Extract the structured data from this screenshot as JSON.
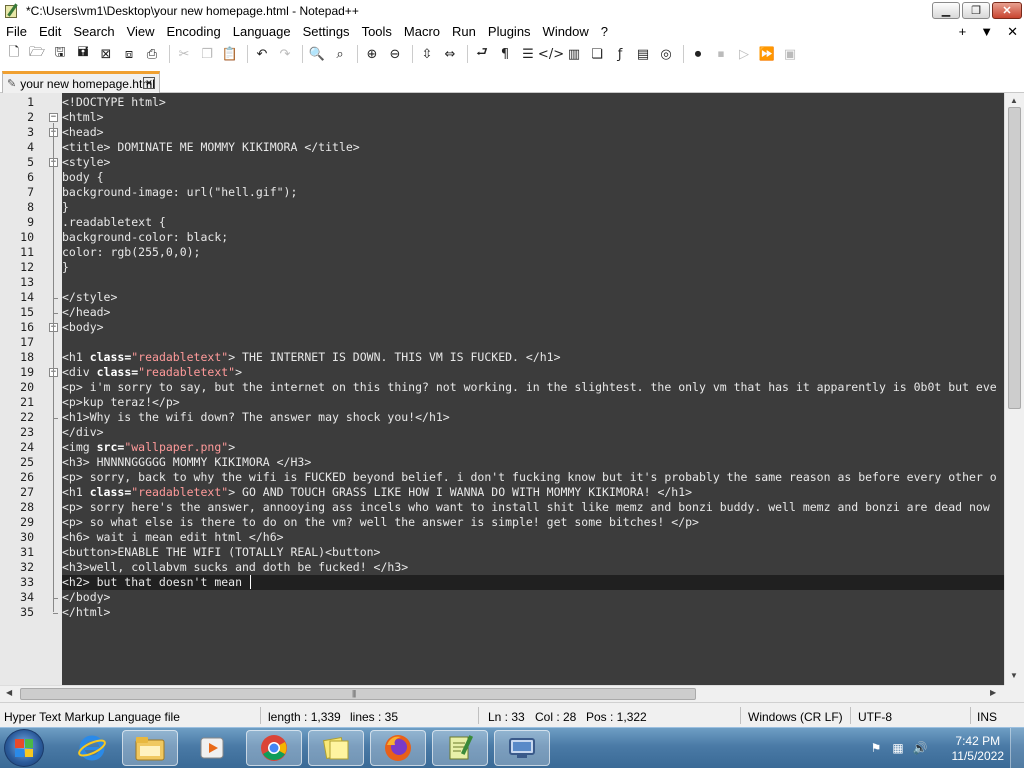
{
  "window": {
    "title": "*C:\\Users\\vm1\\Desktop\\your new homepage.html - Notepad++",
    "minimize_glyph": "▁",
    "maximize_glyph": "❐",
    "close_glyph": "✕"
  },
  "menu": {
    "items": [
      "File",
      "Edit",
      "Search",
      "View",
      "Encoding",
      "Language",
      "Settings",
      "Tools",
      "Macro",
      "Run",
      "Plugins",
      "Window",
      "?"
    ],
    "right": [
      "+",
      "▼",
      "✕"
    ]
  },
  "toolbar": {
    "icons": [
      "new-file-icon",
      "open-file-icon",
      "save-icon",
      "save-all-icon",
      "close-icon",
      "close-all-icon",
      "print-icon",
      "cut-icon",
      "copy-icon",
      "paste-icon",
      "undo-icon",
      "redo-icon",
      "find-icon",
      "replace-icon",
      "zoom-in-icon",
      "zoom-out-icon",
      "sync-vertical-icon",
      "sync-horizontal-icon",
      "word-wrap-icon",
      "show-all-chars-icon",
      "indent-guide-icon",
      "xml-tag-icon",
      "document-map-icon",
      "document-list-icon",
      "function-list-icon",
      "folder-workspace-icon",
      "monitoring-icon",
      "record-macro-icon",
      "stop-macro-icon",
      "play-macro-icon",
      "run-macro-multiple-icon",
      "save-macro-icon"
    ]
  },
  "tab": {
    "label": "your new homepage.html"
  },
  "editor": {
    "lines": [
      "<!DOCTYPE html>",
      "<html>",
      "<head>",
      "<title> DOMINATE ME MOMMY KIKIMORA </title>",
      "<style>",
      "body {",
      "background-image: url(\"hell.gif\");",
      "}",
      ".readabletext {",
      "background-color: black;",
      "color: rgb(255,0,0);",
      "}",
      "",
      "</style>",
      "</head>",
      "<body>",
      "",
      "<h1 class=\"readabletext\"> THE INTERNET IS DOWN. THIS VM IS FUCKED. </h1>",
      "<div class=\"readabletext\">",
      "<p> i'm sorry to say, but the internet on this thing? not working. in the slightest. the only vm that has it apparently is 0b0t but eve",
      "<p>kup teraz!</p>",
      "<h1>Why is the wifi down? The answer may shock you!</h1>",
      "</div>",
      "<img src=\"wallpaper.png\">",
      "<h3> HNNNNGGGGG MOMMY KIKIMORA </H3>",
      "<p> sorry, back to why the wifi is FUCKED beyond belief. i don't fucking know but it's probably the same reason as before every other o",
      "<h1 class=\"readabletext\"> GO AND TOUCH GRASS LIKE HOW I WANNA DO WITH MOMMY KIKIMORA! </h1>",
      "<p> sorry here's the answer, annooying ass incels who want to install shit like memz and bonzi buddy. well memz and bonzi are dead now",
      "<p> so what else is there to do on the vm? well the answer is simple! get some bitches! </p>",
      "<h6> wait i mean edit html </h6>",
      "<button>ENABLE THE WIFI (TOTALLY REAL)<button>",
      "<h3>well, collabvm sucks and doth be fucked! </h3>",
      "<h2> but that doesn't mean",
      "</body>",
      "</html>"
    ],
    "current_line": 33
  },
  "status": {
    "language": "Hyper Text Markup Language file",
    "length": "length : 1,339",
    "lines": "lines : 35",
    "ln": "Ln : 33",
    "col": "Col : 28",
    "pos": "Pos : 1,322",
    "eol": "Windows (CR LF)",
    "encoding": "UTF-8",
    "mode": "INS"
  },
  "taskbar": {
    "items": [
      "internet-explorer-icon",
      "windows-explorer-icon",
      "media-player-icon",
      "chrome-icon",
      "sticky-notes-icon",
      "firefox-icon",
      "notepad-plus-plus-icon",
      "remote-desktop-icon"
    ],
    "time": "7:42 PM",
    "date": "11/5/2022"
  },
  "colors": {
    "editor_bg": "#3c3c3c",
    "current_line_bg": "#202020",
    "string_color": "#ff9a9a",
    "tab_accent": "#f0a030"
  }
}
